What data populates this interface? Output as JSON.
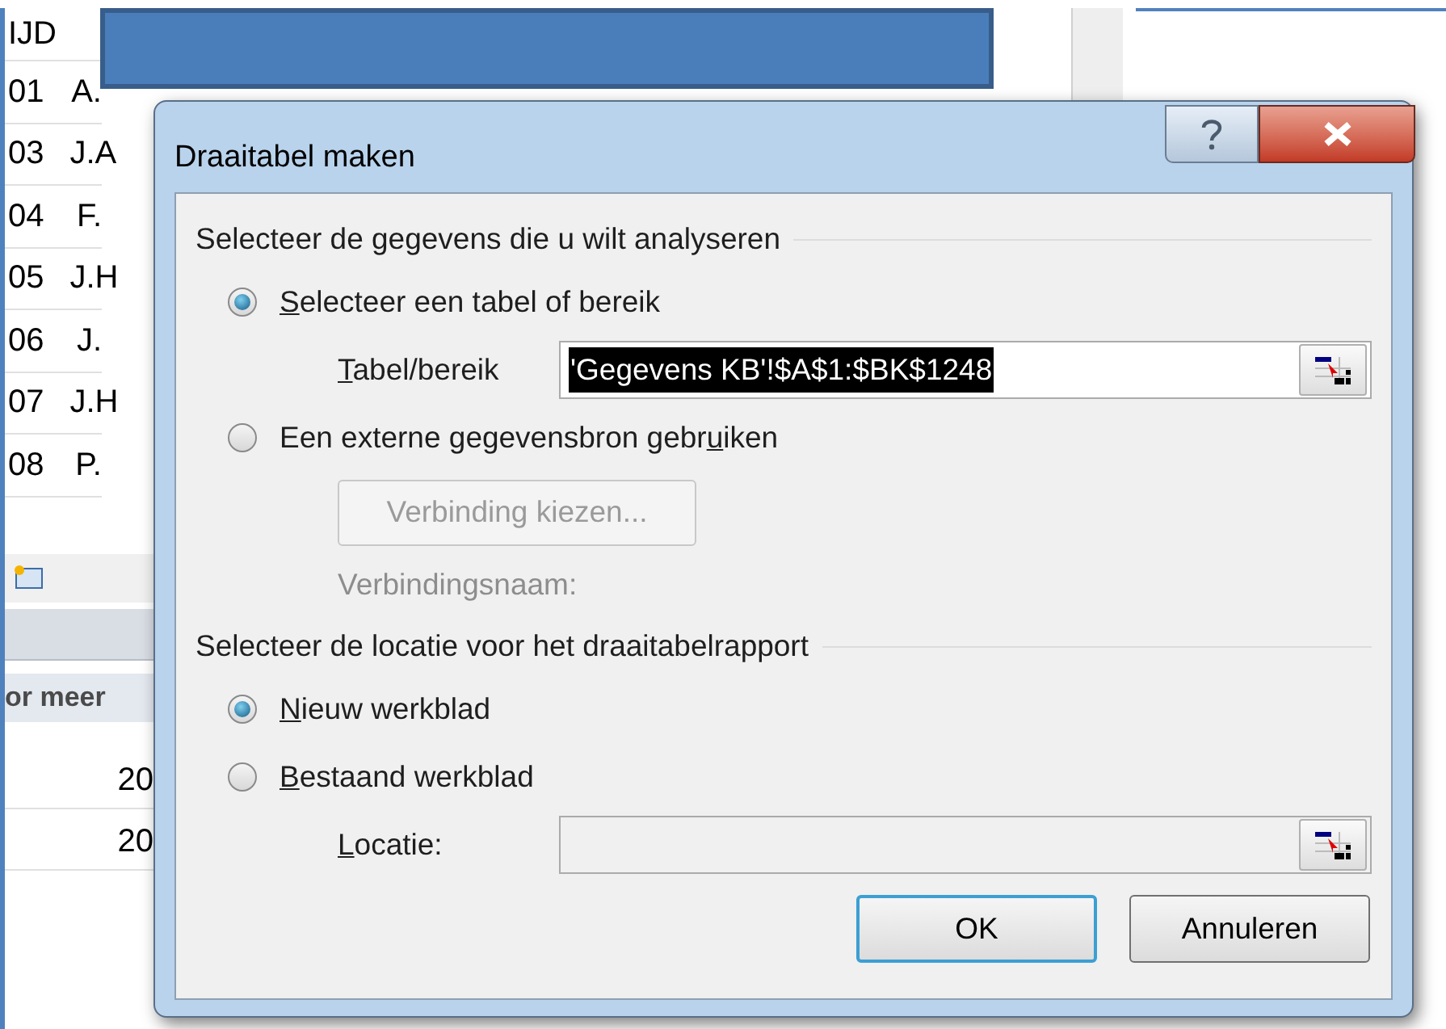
{
  "spreadsheet": {
    "header": "IJD",
    "rows": [
      {
        "id": "01",
        "name": "A."
      },
      {
        "id": "03",
        "name": "J.A"
      },
      {
        "id": "04",
        "name": "F."
      },
      {
        "id": "05",
        "name": "J.H"
      },
      {
        "id": "06",
        "name": "J."
      },
      {
        "id": "07",
        "name": "J.H"
      },
      {
        "id": "08",
        "name": "P."
      }
    ],
    "column_header": "or meer",
    "values": [
      "20",
      "20"
    ]
  },
  "dialog": {
    "title": "Draaitabel maken",
    "section_1": "Selecteer de gegevens die u wilt analyseren",
    "source_options": [
      {
        "kind": "radio",
        "key": "S",
        "after": "electeer een tabel of bereik",
        "selected": true
      },
      {
        "kind": "range",
        "key": "T",
        "after": "abel/bereik",
        "value": "'Gegevens KB'!$A$1:$BK$1248",
        "disabled": false
      },
      {
        "kind": "radio",
        "before": "Een externe gegevensbron gebr",
        "key": "u",
        "after": "iken",
        "selected": false
      },
      {
        "kind": "button",
        "label": "Verbinding kiezen...",
        "disabled": true
      },
      {
        "kind": "note",
        "label": "Verbindingsnaam:",
        "disabled": true
      }
    ],
    "section_2": "Selecteer de locatie voor het draaitabelrapport",
    "location_options": [
      {
        "kind": "radio",
        "key": "N",
        "after": "ieuw werkblad",
        "selected": true
      },
      {
        "kind": "radio",
        "key": "B",
        "after": "estaand werkblad",
        "selected": false
      },
      {
        "kind": "range",
        "key": "L",
        "after": "ocatie:",
        "disabled": true
      }
    ],
    "buttons": [
      {
        "label": "OK",
        "default": true
      },
      {
        "label": "Annuleren",
        "default": false
      }
    ]
  }
}
